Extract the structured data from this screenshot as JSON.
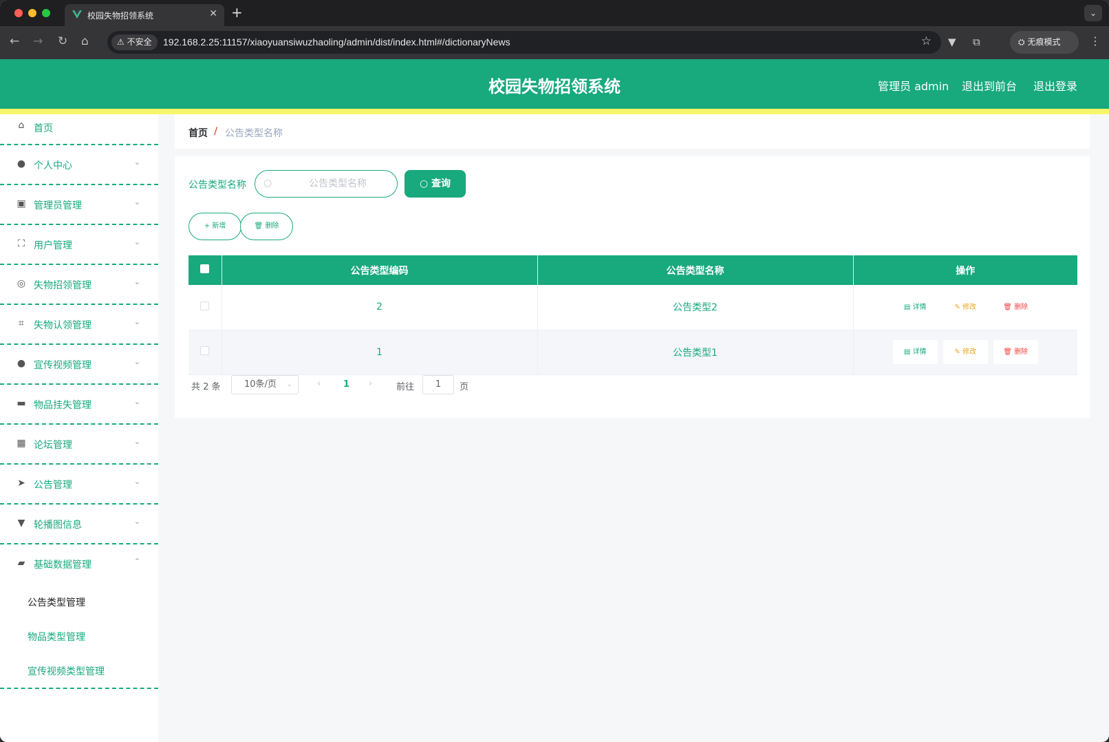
{
  "browser": {
    "tab_title": "校园失物招领系统",
    "new_tab": "+",
    "security_label": "不安全",
    "url": "192.168.2.25:11157/xiaoyuansiwuzhaoling/admin/dist/index.html#/dictionaryNews",
    "incognito_label": "无痕模式"
  },
  "header": {
    "title": "校园失物招领系统",
    "user_label": "管理员 admin",
    "front_link": "退出到前台",
    "logout_link": "退出登录"
  },
  "sidebar": {
    "items": [
      {
        "label": "首页",
        "icon": "home-icon"
      },
      {
        "label": "个人中心",
        "icon": "user-icon"
      },
      {
        "label": "管理员管理",
        "icon": "clipboard-icon"
      },
      {
        "label": "用户管理",
        "icon": "fullscreen-icon"
      },
      {
        "label": "失物招领管理",
        "icon": "compass-icon"
      },
      {
        "label": "失物认领管理",
        "icon": "crop-icon"
      },
      {
        "label": "宣传视频管理",
        "icon": "user-icon"
      },
      {
        "label": "物品挂失管理",
        "icon": "briefcase-icon"
      },
      {
        "label": "论坛管理",
        "icon": "grid-icon"
      },
      {
        "label": "公告管理",
        "icon": "send-icon"
      },
      {
        "label": "轮播图信息",
        "icon": "brush-icon"
      },
      {
        "label": "基础数据管理",
        "icon": "ticket-icon"
      }
    ],
    "sub_items": [
      {
        "label": "公告类型管理"
      },
      {
        "label": "物品类型管理"
      },
      {
        "label": "宣传视频类型管理"
      }
    ]
  },
  "breadcrumb": {
    "home": "首页",
    "separator": "/",
    "current": "公告类型名称"
  },
  "search": {
    "label": "公告类型名称",
    "placeholder": "公告类型名称",
    "query_button": "查询"
  },
  "actions": {
    "add": "新增",
    "delete": "删除"
  },
  "table": {
    "columns": [
      "公告类型编码",
      "公告类型名称",
      "操作"
    ],
    "rows": [
      {
        "code": "2",
        "name": "公告类型2"
      },
      {
        "code": "1",
        "name": "公告类型1"
      }
    ],
    "ops": {
      "detail": "详情",
      "edit": "修改",
      "remove": "删除"
    }
  },
  "pagination": {
    "total": "共 2 条",
    "page_size": "10条/页",
    "current_page": "1",
    "goto_label": "前往",
    "goto_value": "1",
    "page_suffix": "页"
  },
  "colors": {
    "primary": "#18a97d",
    "accent_stripe": "#f7f66b",
    "edit": "#f0a41a",
    "danger": "#f24646"
  }
}
